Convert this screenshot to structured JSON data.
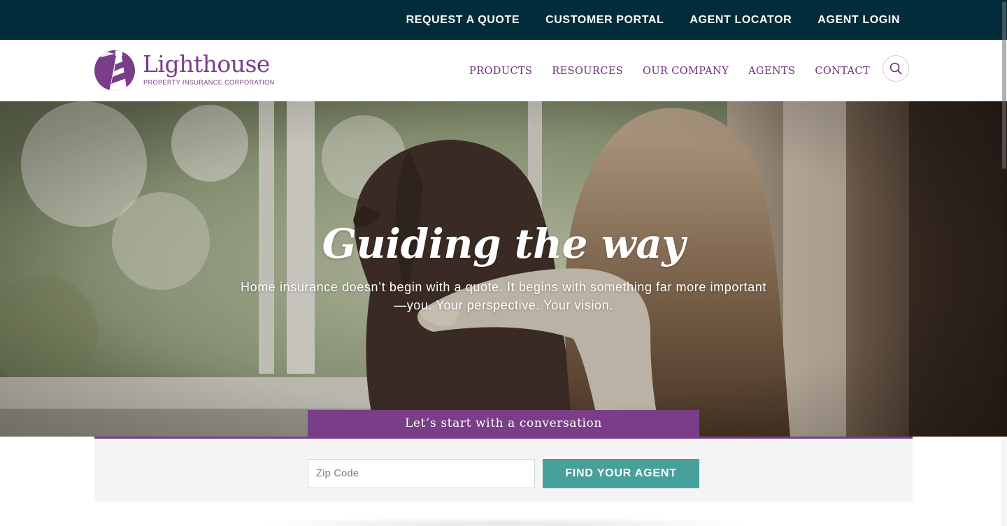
{
  "topbar": {
    "links": [
      "REQUEST A QUOTE",
      "CUSTOMER PORTAL",
      "AGENT LOCATOR",
      "AGENT LOGIN"
    ]
  },
  "header": {
    "logo": {
      "name": "Lighthouse",
      "tagline": "PROPERTY INSURANCE CORPORATION"
    },
    "nav": [
      "PRODUCTS",
      "RESOURCES",
      "OUR COMPANY",
      "AGENTS",
      "CONTACT"
    ],
    "search_icon": "search-icon"
  },
  "hero": {
    "title": "Guiding the way",
    "subtitle": "Home insurance doesn’t begin with a quote. It begins with something far more important—you. Your perspective. Your vision.",
    "cta_banner": "Let’s start with a conversation"
  },
  "agent_search": {
    "zip_placeholder": "Zip Code",
    "zip_value": "",
    "button_label": "FIND YOUR AGENT"
  },
  "colors": {
    "topbar_bg": "#022c3a",
    "brand_purple": "#7a3e88",
    "nav_purple": "#6b2f78",
    "teal_button": "#48a09b",
    "panel_bg": "#f4f4f5"
  }
}
